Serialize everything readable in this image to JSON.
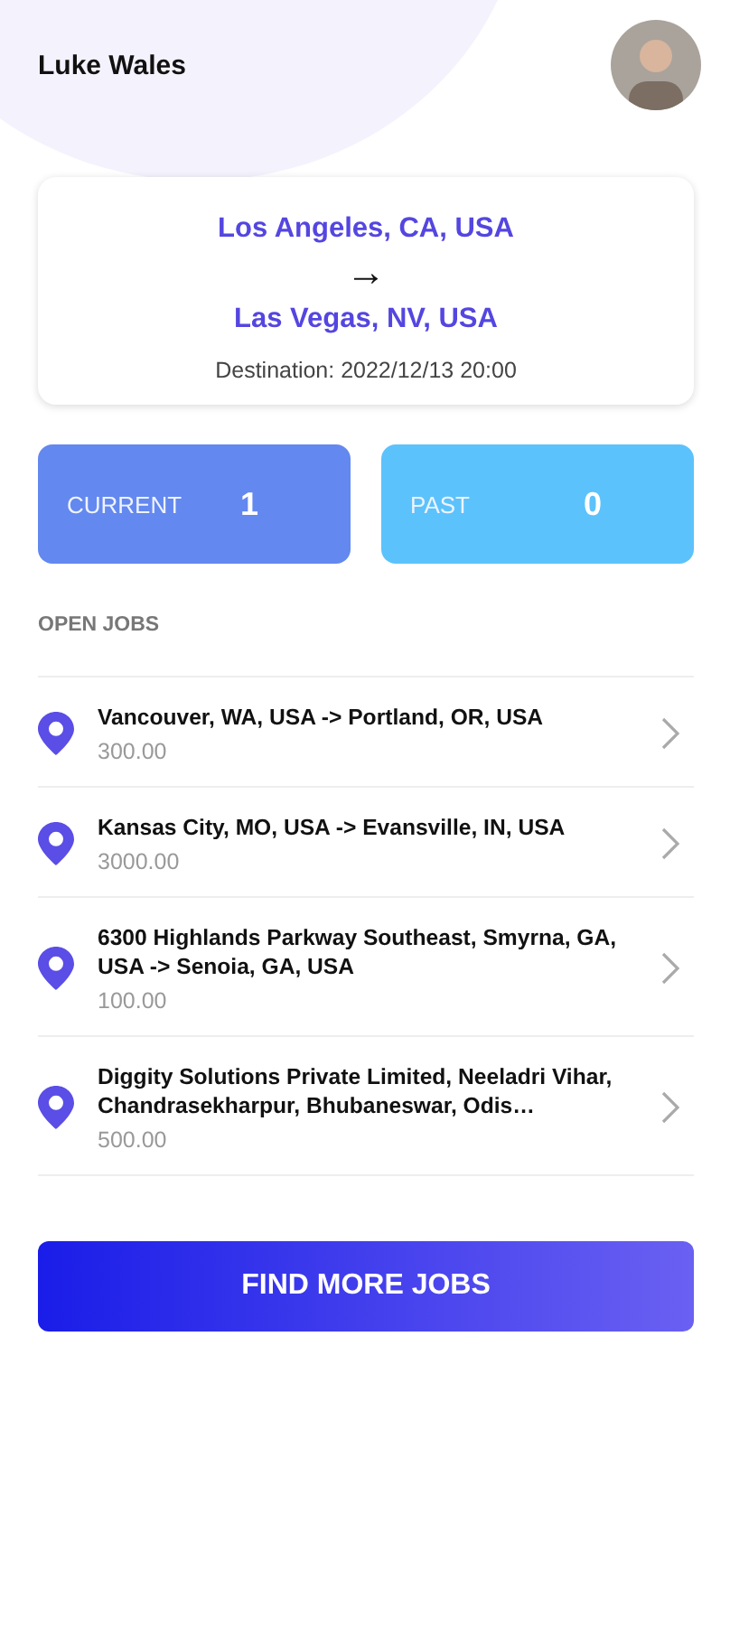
{
  "header": {
    "name": "Luke Wales"
  },
  "trip": {
    "from": "Los Angeles, CA, USA",
    "arrow": "→",
    "to": "Las Vegas, NV, USA",
    "destination": "Destination: 2022/12/13 20:00"
  },
  "stats": [
    {
      "label": "CURRENT",
      "count": "1",
      "color": "#6388ef"
    },
    {
      "label": "PAST",
      "count": "0",
      "color": "#5cc2fb"
    }
  ],
  "open_jobs": {
    "title": "OPEN JOBS",
    "jobs": [
      {
        "route": "Vancouver, WA, USA -> Portland, OR, USA",
        "price": "300.00"
      },
      {
        "route": "Kansas City, MO, USA -> Evansville, IN, USA",
        "price": "3000.00"
      },
      {
        "route": "6300 Highlands Parkway Southeast, Smyrna, GA, USA -> Senoia, GA, USA",
        "price": "100.00"
      },
      {
        "route": "Diggity Solutions Private Limited, Neeladri Vihar, Chandrasekharpur, Bhubaneswar, Odis…",
        "price": "500.00"
      }
    ]
  },
  "button": "FIND MORE JOBS"
}
